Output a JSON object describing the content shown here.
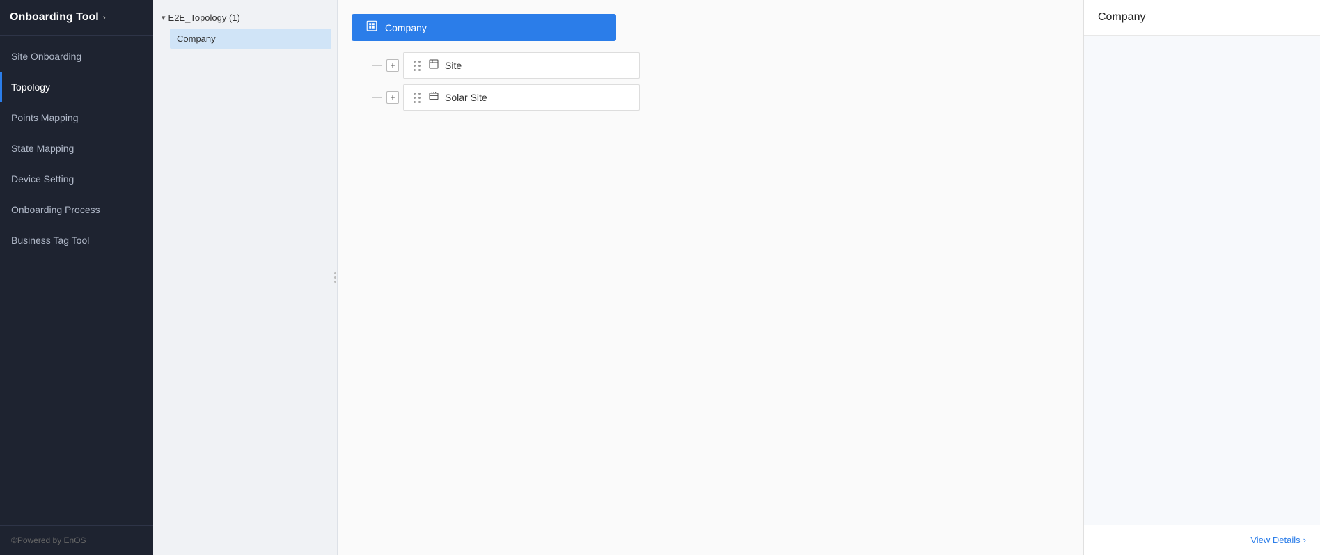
{
  "sidebar": {
    "header": {
      "title": "Onboarding Tool",
      "chevron": "›"
    },
    "items": [
      {
        "id": "site-onboarding",
        "label": "Site Onboarding",
        "active": false
      },
      {
        "id": "topology",
        "label": "Topology",
        "active": true
      },
      {
        "id": "points-mapping",
        "label": "Points Mapping",
        "active": false
      },
      {
        "id": "state-mapping",
        "label": "State Mapping",
        "active": false
      },
      {
        "id": "device-setting",
        "label": "Device Setting",
        "active": false
      },
      {
        "id": "onboarding-process",
        "label": "Onboarding Process",
        "active": false
      },
      {
        "id": "business-tag-tool",
        "label": "Business Tag Tool",
        "active": false
      }
    ],
    "footer": "©Powered by EnOS"
  },
  "tree": {
    "root": {
      "label": "E2E_Topology (1)",
      "expanded": true
    },
    "children": [
      {
        "id": "company",
        "label": "Company",
        "selected": true
      }
    ]
  },
  "topology": {
    "root_node": {
      "label": "Company",
      "icon": "🏢"
    },
    "child_nodes": [
      {
        "id": "site",
        "label": "Site",
        "icon": "🏗️"
      },
      {
        "id": "solar-site",
        "label": "Solar Site",
        "icon": "🏭"
      }
    ]
  },
  "detail_panel": {
    "title": "Company",
    "view_details_label": "View Details",
    "view_details_arrow": "›"
  },
  "icons": {
    "drag_handle": "⠿",
    "expand": "+",
    "collapse": "▾",
    "chevron_right": "›"
  }
}
